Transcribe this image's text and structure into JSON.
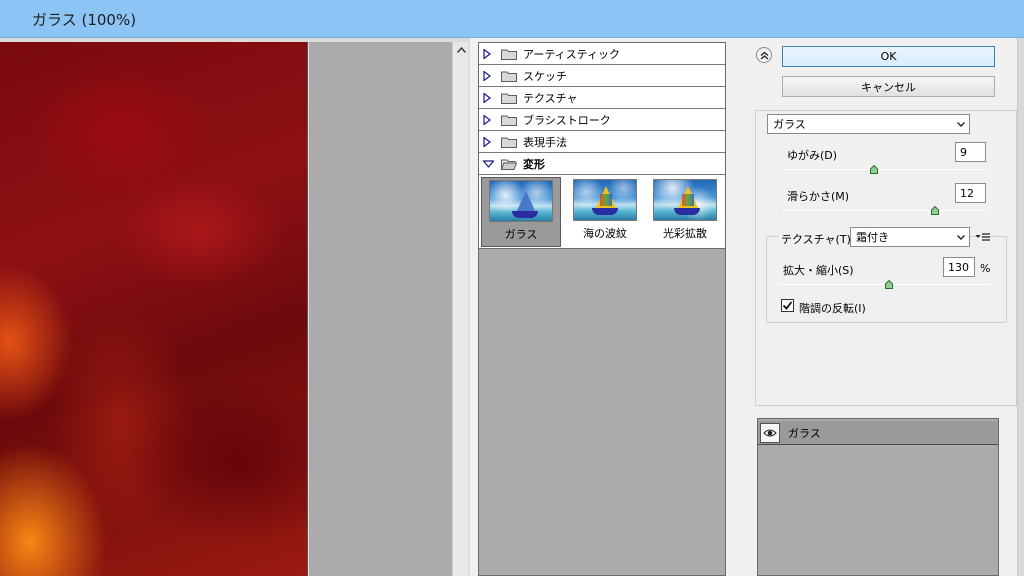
{
  "window": {
    "title": "ガラス (100%)"
  },
  "gallery": {
    "categories": [
      {
        "label": "アーティスティック",
        "expanded": false
      },
      {
        "label": "スケッチ",
        "expanded": false
      },
      {
        "label": "テクスチャ",
        "expanded": false
      },
      {
        "label": "ブラシストローク",
        "expanded": false
      },
      {
        "label": "表現手法",
        "expanded": false
      },
      {
        "label": "変形",
        "expanded": true
      }
    ],
    "filters": [
      {
        "label": "ガラス",
        "selected": true
      },
      {
        "label": "海の波紋",
        "selected": false
      },
      {
        "label": "光彩拡散",
        "selected": false
      }
    ]
  },
  "buttons": {
    "ok": "OK",
    "cancel": "キャンセル"
  },
  "settings": {
    "filter_select": "ガラス",
    "distortion": {
      "label": "ゆがみ(D)",
      "value": "9",
      "level": 0.45
    },
    "smoothness": {
      "label": "滑らかさ(M)",
      "value": "12",
      "level": 0.75
    },
    "texture": {
      "label": "テクスチャ(T)：",
      "value": "霜付き"
    },
    "scaling": {
      "label": "拡大・縮小(S)",
      "value": "130",
      "unit": "%",
      "level": 0.52
    },
    "invert": {
      "label": "階調の反転(I)",
      "checked": true
    }
  },
  "layers": [
    {
      "name": "ガラス",
      "visible": true
    }
  ],
  "icons": {
    "collapse": "double-chevron-up-icon",
    "expand": "triangle-right-icon",
    "expanded": "triangle-down-icon",
    "folder": "folder-icon",
    "eye": "eye-icon",
    "panel_menu": "panel-menu-icon"
  },
  "colors": {
    "titlebar": "#8cc4f5",
    "gallery_bg": "#ababab",
    "preview_red": "#8e1014"
  }
}
